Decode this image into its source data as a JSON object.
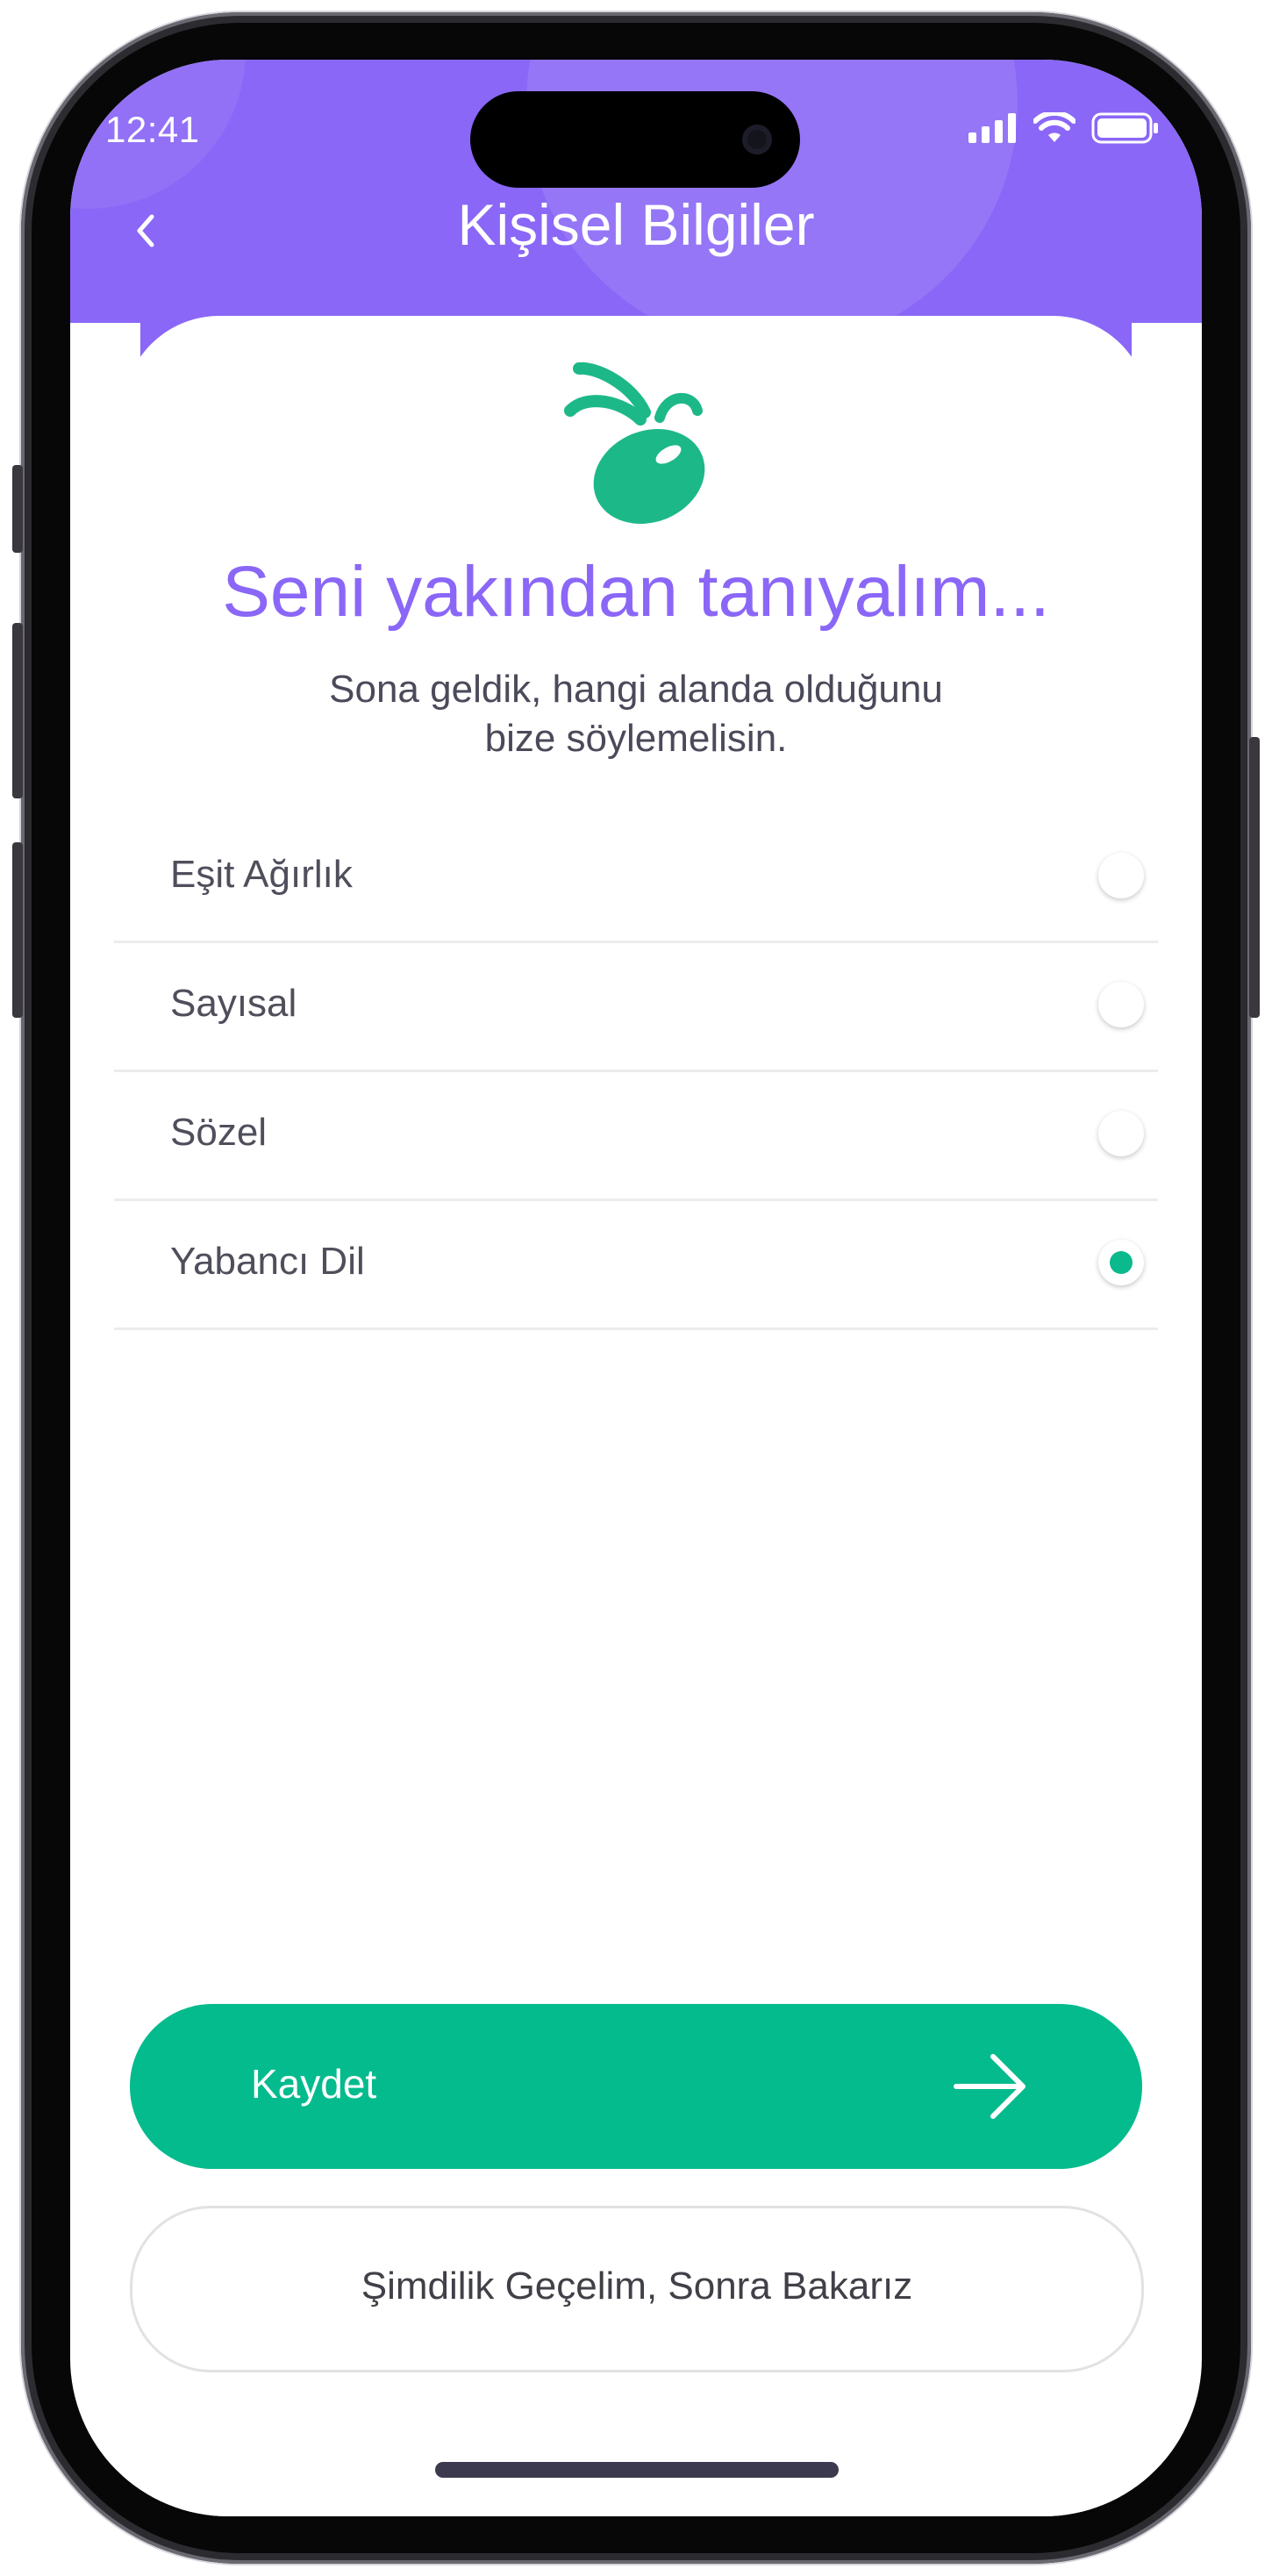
{
  "status_bar": {
    "time": "12:41",
    "icons": [
      "signal-icon",
      "wifi-icon",
      "battery-icon"
    ]
  },
  "header": {
    "back_icon": "chevron-left-icon",
    "title": "Kişisel Bilgiler"
  },
  "content": {
    "logo_icon": "sprout-logo-icon",
    "headline": "Seni yakından tanıyalım...",
    "subtitle_line1": "Sona geldik, hangi alanda olduğunu",
    "subtitle_line2": "bize söylemelisin."
  },
  "options": [
    {
      "label": "Eşit Ağırlık",
      "selected": false
    },
    {
      "label": "Sayısal",
      "selected": false
    },
    {
      "label": "Sözel",
      "selected": false
    },
    {
      "label": "Yabancı Dil",
      "selected": true
    }
  ],
  "actions": {
    "save_label": "Kaydet",
    "save_icon": "arrow-right-icon",
    "skip_label": "Şimdilik Geçelim, Sonra Bakarız"
  },
  "colors": {
    "primary_purple": "#8a67f7",
    "accent_green": "#04bb8d",
    "text_dark": "#4f4f5c"
  }
}
